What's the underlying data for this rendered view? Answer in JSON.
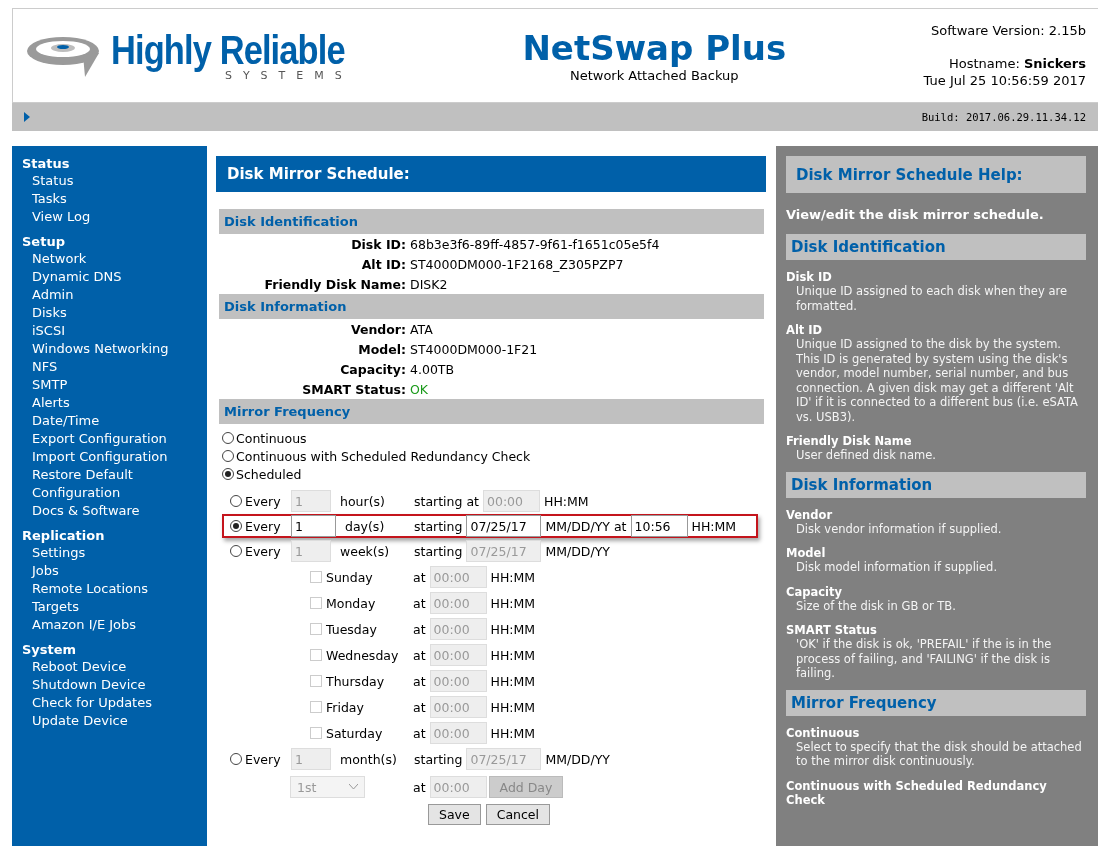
{
  "header": {
    "brand": "Highly Reliable",
    "brand_tagline": "SYSTEMS",
    "product": "NetSwap Plus",
    "product_subtitle": "Network Attached Backup",
    "software_version": "Software Version: 2.15b",
    "hostname_label": "Hostname:",
    "hostname": "Snickers",
    "datetime": "Tue Jul 25 10:56:59 2017",
    "build": "Build: 2017.06.29.11.34.12"
  },
  "sidebar": [
    {
      "title": "Status",
      "items": [
        "Status",
        "Tasks",
        "View Log"
      ]
    },
    {
      "title": "Setup",
      "items": [
        "Network",
        "Dynamic DNS",
        "Admin",
        "Disks",
        "iSCSI",
        "Windows Networking",
        "NFS",
        "SMTP",
        "Alerts",
        "Date/Time",
        "Export Configuration",
        "Import Configuration",
        "Restore Default Configuration",
        "Docs & Software"
      ]
    },
    {
      "title": "Replication",
      "items": [
        "Settings",
        "Jobs",
        "Remote Locations",
        "Targets",
        "Amazon I/E Jobs"
      ]
    },
    {
      "title": "System",
      "items": [
        "Reboot Device",
        "Shutdown Device",
        "Check for Updates",
        "Update Device"
      ]
    }
  ],
  "main": {
    "title": "Disk Mirror Schedule:",
    "sections": [
      {
        "title": "Disk Identification",
        "fields": [
          {
            "label": "Disk ID:",
            "value": "68b3e3f6-89ff-4857-9f61-f1651c05e5f4",
            "kind": "text"
          },
          {
            "label": "Alt ID:",
            "value": "ST4000DM000-1F2168_Z305PZP7",
            "kind": "text"
          },
          {
            "label": "Friendly Disk Name:",
            "value": "DISK2",
            "kind": "text"
          }
        ]
      },
      {
        "title": "Disk Information",
        "fields": [
          {
            "label": "Vendor:",
            "value": "ATA",
            "kind": "text"
          },
          {
            "label": "Model:",
            "value": "ST4000DM000-1F21",
            "kind": "text"
          },
          {
            "label": "Capacity:",
            "value": "4.00TB",
            "kind": "text"
          },
          {
            "label": "SMART Status:",
            "value": "OK",
            "kind": "status"
          }
        ]
      }
    ],
    "frequency_title": "Mirror Frequency",
    "modes": [
      {
        "label": "Continuous",
        "selected": false
      },
      {
        "label": "Continuous with Scheduled Redundancy Check",
        "selected": false
      },
      {
        "label": "Scheduled",
        "selected": true
      }
    ],
    "hourly": {
      "every": "Every",
      "selected": false,
      "highlighted": false,
      "disabled": true,
      "count": "1",
      "unit": "hour(s)",
      "start_label": "starting at",
      "start": "00:00",
      "start_format": "HH:MM"
    },
    "daily": {
      "every": "Every",
      "selected": true,
      "highlighted": true,
      "disabled": false,
      "count": "1",
      "unit": "day(s)",
      "start_label": "starting",
      "start": "07/25/17",
      "start_format": "MM/DD/YY at",
      "time": "10:56",
      "time_format": "HH:MM"
    },
    "weekly": {
      "every": "Every",
      "selected": false,
      "highlighted": false,
      "disabled": true,
      "count": "1",
      "unit": "week(s)",
      "start_label": "starting",
      "start": "07/25/17",
      "start_format": "MM/DD/YY"
    },
    "days": [
      {
        "label": "Sunday",
        "checked": false,
        "at": "at",
        "time": "00:00",
        "format": "HH:MM"
      },
      {
        "label": "Monday",
        "checked": false,
        "at": "at",
        "time": "00:00",
        "format": "HH:MM"
      },
      {
        "label": "Tuesday",
        "checked": false,
        "at": "at",
        "time": "00:00",
        "format": "HH:MM"
      },
      {
        "label": "Wednesday",
        "checked": false,
        "at": "at",
        "time": "00:00",
        "format": "HH:MM"
      },
      {
        "label": "Thursday",
        "checked": false,
        "at": "at",
        "time": "00:00",
        "format": "HH:MM"
      },
      {
        "label": "Friday",
        "checked": false,
        "at": "at",
        "time": "00:00",
        "format": "HH:MM"
      },
      {
        "label": "Saturday",
        "checked": false,
        "at": "at",
        "time": "00:00",
        "format": "HH:MM"
      }
    ],
    "monthly": {
      "every": "Every",
      "selected": false,
      "highlighted": false,
      "disabled": true,
      "count": "1",
      "unit": "month(s)",
      "start_label": "starting",
      "start": "07/25/17",
      "start_format": "MM/DD/YY",
      "day": "1st",
      "at": "at",
      "time": "00:00",
      "add_button": "Add Day"
    },
    "buttons": [
      "Save",
      "Cancel"
    ]
  },
  "help": {
    "title": "Disk Mirror Schedule Help:",
    "intro": "View/edit the disk mirror schedule.",
    "sections": [
      {
        "title": "Disk Identification",
        "entries": [
          {
            "term": "Disk ID",
            "text": "Unique ID assigned to each disk when they are formatted."
          },
          {
            "term": "Alt ID",
            "text": "Unique ID assigned to the disk by the system. This ID is generated by system using the disk's vendor, model number, serial number, and bus connection. A given disk may get a different 'Alt ID' if it is connected to a different bus (i.e. eSATA vs. USB3)."
          },
          {
            "term": "Friendly Disk Name",
            "text": "User defined disk name."
          }
        ]
      },
      {
        "title": "Disk Information",
        "entries": [
          {
            "term": "Vendor",
            "text": "Disk vendor information if supplied."
          },
          {
            "term": "Model",
            "text": "Disk model information if supplied."
          },
          {
            "term": "Capacity",
            "text": "Size of the disk in GB or TB."
          },
          {
            "term": "SMART Status",
            "text": "'OK' if the disk is ok, 'PREFAIL' if the is in the process of failing, and 'FAILING' if the disk is failing."
          }
        ]
      },
      {
        "title": "Mirror Frequency",
        "entries": [
          {
            "term": "Continuous",
            "text": "Select to specify that the disk should be attached to the mirror disk continuously."
          },
          {
            "term": "Continuous with Scheduled Redundancy Check"
          }
        ]
      }
    ]
  }
}
